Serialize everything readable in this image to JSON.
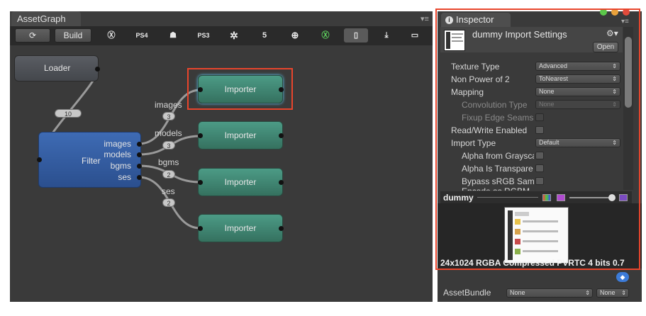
{
  "graph_window": {
    "tab_title": "AssetGraph",
    "toolbar": {
      "build_label": "Build",
      "platforms": [
        {
          "name": "xbox-360",
          "glyph": "Ⓧ"
        },
        {
          "name": "ps4",
          "glyph": "PS4"
        },
        {
          "name": "android",
          "glyph": "☗"
        },
        {
          "name": "ps3",
          "glyph": "PS3"
        },
        {
          "name": "unity",
          "glyph": "✲"
        },
        {
          "name": "html5",
          "glyph": "5"
        },
        {
          "name": "web",
          "glyph": "⊕"
        },
        {
          "name": "xbox-one",
          "glyph": "Ⓧ"
        },
        {
          "name": "ios",
          "glyph": "▯"
        },
        {
          "name": "standalone",
          "glyph": "⤓"
        },
        {
          "name": "wiiu",
          "glyph": "▭"
        }
      ]
    },
    "nodes": {
      "loader": "Loader",
      "filter": "Filter",
      "importer": "Importer"
    },
    "filter_outputs": [
      "images",
      "models",
      "bgms",
      "ses"
    ],
    "connections": [
      {
        "label": "images",
        "count": "3"
      },
      {
        "label": "models",
        "count": "3"
      },
      {
        "label": "bgms",
        "count": "2"
      },
      {
        "label": "ses",
        "count": "2"
      }
    ],
    "loader_count": "10"
  },
  "inspector": {
    "tab_title": "Inspector",
    "title": "dummy Import Settings",
    "open_label": "Open",
    "properties": {
      "texture_type": {
        "label": "Texture Type",
        "value": "Advanced"
      },
      "npot": {
        "label": "Non Power of 2",
        "value": "ToNearest"
      },
      "mapping": {
        "label": "Mapping",
        "value": "None"
      },
      "convolution": {
        "label": "Convolution Type",
        "value": "None"
      },
      "fixup": {
        "label": "Fixup Edge Seams"
      },
      "readwrite": {
        "label": "Read/Write Enabled"
      },
      "import_type": {
        "label": "Import Type",
        "value": "Default"
      },
      "alpha_gray": {
        "label": "Alpha from Graysca"
      },
      "alpha_transparent": {
        "label": "Alpha Is Transpare"
      },
      "bypass_srgb": {
        "label": "Bypass sRGB Sampl"
      },
      "encode_rgbm": {
        "label": "Encode as RGBM"
      }
    },
    "preview": {
      "name": "dummy",
      "info": "24x1024  RGBA Compressed PVRTC 4 bits   0.7"
    },
    "asset_bundle": {
      "label": "AssetBundle",
      "name_value": "None",
      "variant_value": "None"
    }
  },
  "colors": {
    "highlight": "#e8452c",
    "importer_green": "#3f8a76",
    "filter_blue": "#335ca0"
  }
}
